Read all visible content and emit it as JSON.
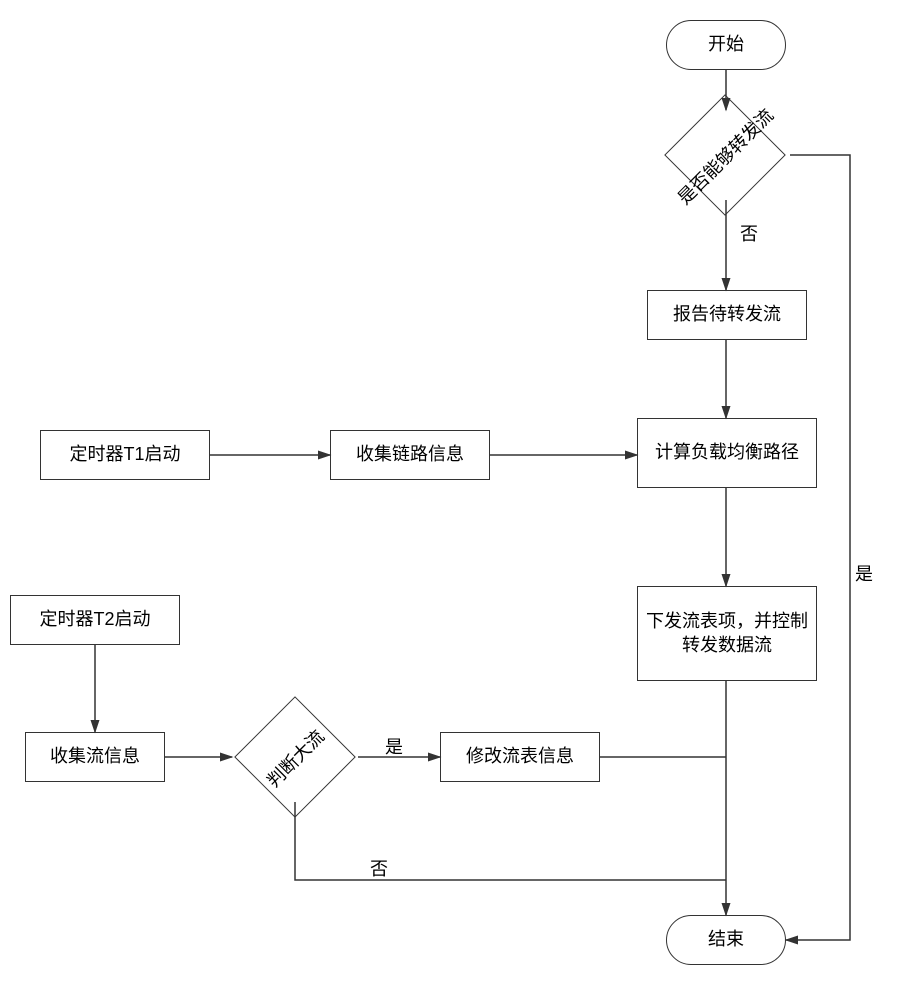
{
  "nodes": {
    "start": "开始",
    "decision_forward": "是否能够转发流",
    "report_flow": "报告待转发流",
    "timer_t1": "定时器T1启动",
    "collect_link": "收集链路信息",
    "calc_balance": "计算负载均衡路径",
    "deliver_flow": "下发流表项，并控制转发数据流",
    "timer_t2": "定时器T2启动",
    "collect_flow": "收集流信息",
    "decision_large": "判断大流",
    "modify_flow": "修改流表信息",
    "end": "结束"
  },
  "labels": {
    "yes": "是",
    "no": "否"
  }
}
